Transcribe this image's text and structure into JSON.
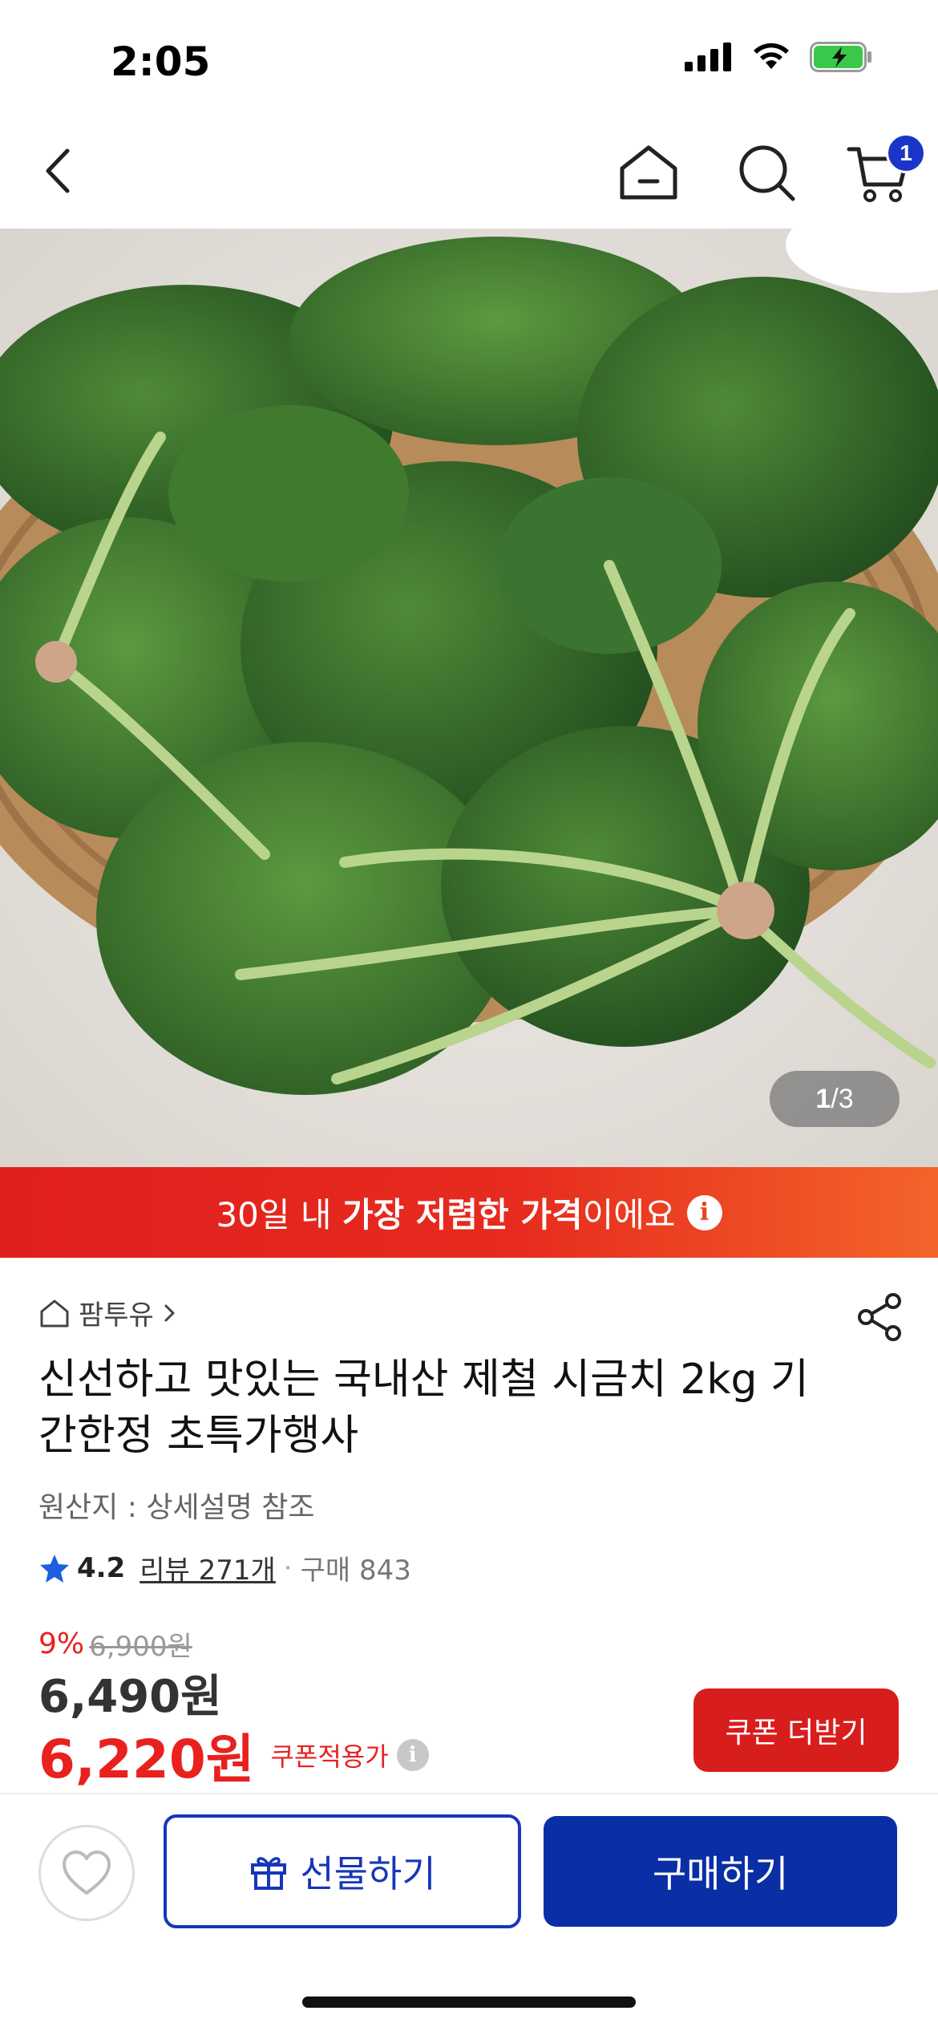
{
  "status_bar": {
    "time": "2:05"
  },
  "nav": {
    "cart_count": "1"
  },
  "gallery": {
    "current": "1",
    "separator": "/",
    "total": "3"
  },
  "promo": {
    "prefix": "30일 내 ",
    "highlight": "가장 저렴한 가격",
    "suffix": "이에요",
    "info_icon": "i"
  },
  "product": {
    "seller_name": "팜투유",
    "title": "신선하고 맛있는 국내산 제철 시금치 2kg 기간한정 초특가행사",
    "origin": "원산지 : 상세설명 참조",
    "rating": "4.2",
    "review_text": "리뷰 271개",
    "purchase_text": "구매 843"
  },
  "price": {
    "discount_rate": "9%",
    "original_price": "6,900원",
    "sale_price": "6,490원",
    "coupon_price": "6,220원",
    "coupon_label": "쿠폰적용가",
    "coupon_button": "쿠폰 더받기"
  },
  "actions": {
    "gift_label": "선물하기",
    "buy_label": "구매하기"
  },
  "colors": {
    "promo_red": "#e01f1f",
    "price_red": "#e8211f",
    "primary_blue": "#0a2ea6"
  },
  "icons": [
    "back-arrow-icon",
    "home-icon",
    "search-icon",
    "cart-icon",
    "share-icon",
    "star-icon",
    "heart-icon",
    "gift-icon",
    "info-icon"
  ]
}
